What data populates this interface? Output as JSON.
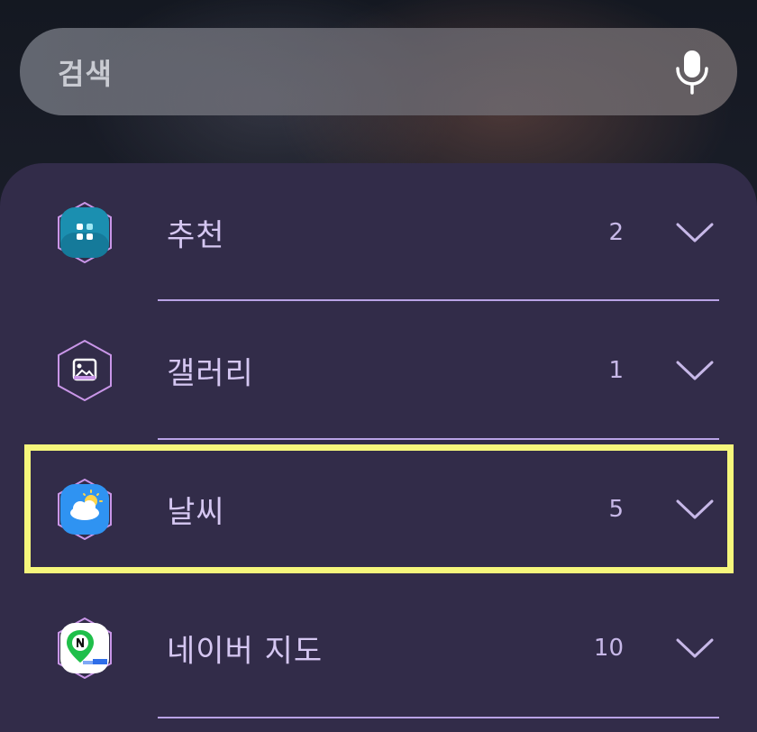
{
  "search": {
    "placeholder": "검색",
    "mic_icon": "microphone-icon"
  },
  "items": [
    {
      "label": "추천",
      "count": "2",
      "icon": "recommend-icon"
    },
    {
      "label": "갤러리",
      "count": "1",
      "icon": "gallery-icon"
    },
    {
      "label": "날씨",
      "count": "5",
      "icon": "weather-icon"
    },
    {
      "label": "네이버 지도",
      "count": "10",
      "icon": "naver-map-icon"
    }
  ],
  "colors": {
    "panel": "#322c49",
    "label": "#d5c7f2",
    "divider": "#b9a3e6",
    "highlight": "#f6f77c"
  }
}
